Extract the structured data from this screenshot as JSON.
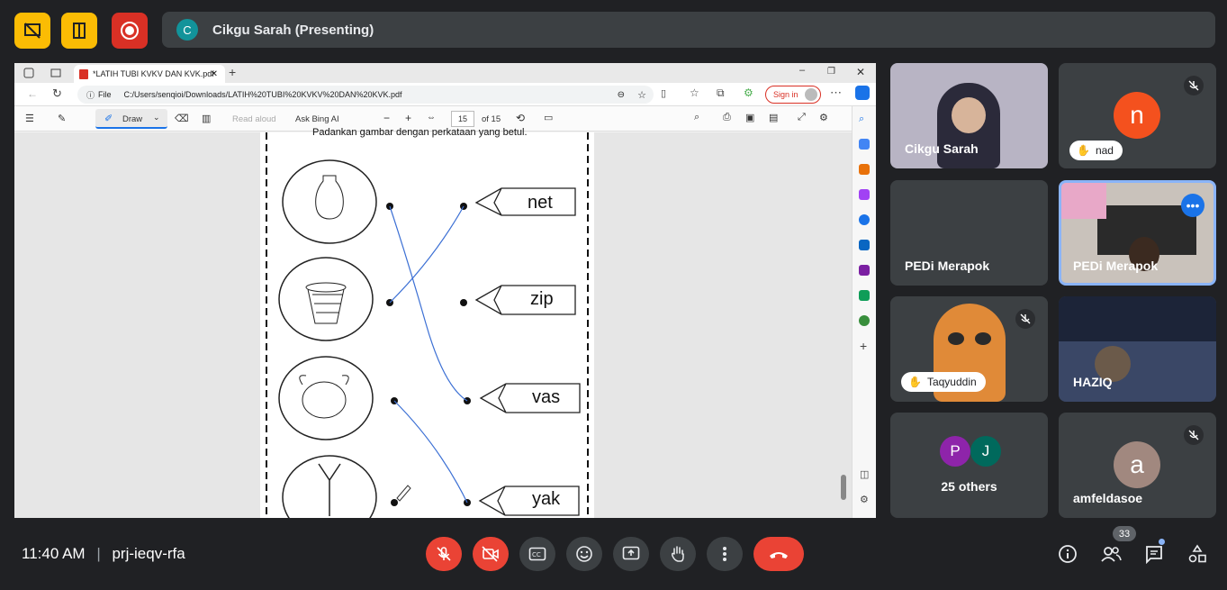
{
  "top": {
    "presenter_initial": "C",
    "presenter_label": "Cikgu Sarah (Presenting)"
  },
  "browser": {
    "tab_title": "*LATIH TUBI KVKV DAN KVK.pdf",
    "url_prefix": "File",
    "url": "C:/Users/senqioi/Downloads/LATIH%20TUBI%20KVKV%20DAN%20KVK.pdf",
    "sign_in": "Sign in"
  },
  "pdf_toolbar": {
    "draw": "Draw",
    "read_aloud": "Read aloud",
    "ask_bing": "Ask Bing AI",
    "page_num": "15",
    "page_total": "of 15"
  },
  "worksheet": {
    "instruction": "Padankan gambar dengan perkataan yang betul.",
    "words": [
      "net",
      "zip",
      "vas",
      "yak"
    ]
  },
  "participants": [
    {
      "name": "Cikgu Sarah"
    },
    {
      "name": "nad",
      "initial": "n",
      "color": "#f4511e"
    },
    {
      "name": "PEDi Merapok"
    },
    {
      "name": "PEDi Merapok"
    },
    {
      "name": "Taqyuddin"
    },
    {
      "name": "HAZIQ"
    },
    {
      "others_label": "25 others",
      "initials": [
        "P",
        "J"
      ],
      "colors": [
        "#8e24aa",
        "#00695c"
      ]
    },
    {
      "name": "amfeldasoe",
      "initial": "a",
      "color": "#a1887f"
    }
  ],
  "bottom": {
    "time": "11:40 AM",
    "separator": "|",
    "meeting_code": "prj-ieqv-rfa",
    "people_count": "33"
  }
}
